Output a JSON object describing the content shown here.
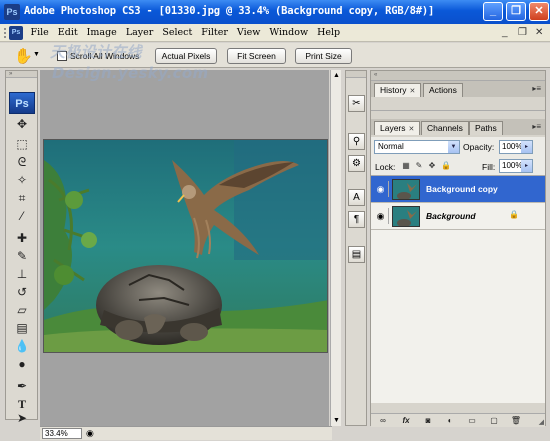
{
  "window": {
    "title": "Adobe Photoshop CS3 - [01330.jpg @ 33.4% (Background copy, RGB/8#)]",
    "logo": "Ps"
  },
  "menubar": {
    "items": [
      "File",
      "Edit",
      "Image",
      "Layer",
      "Select",
      "Filter",
      "View",
      "Window",
      "Help"
    ]
  },
  "watermark": {
    "line1": "天极设计在线",
    "line2": "Design.yesky.com"
  },
  "options": {
    "scroll_all_label": "Scroll All Windows",
    "scroll_all_checked": false,
    "actual_pixels": "Actual Pixels",
    "fit_screen": "Fit Screen",
    "print_size": "Print Size"
  },
  "toolbox": {
    "logo": "Ps",
    "tools": [
      "move-tool",
      "marquee-tool",
      "lasso-tool",
      "magic-wand-tool",
      "crop-tool",
      "slice-tool",
      "healing-brush-tool",
      "brush-tool",
      "clone-stamp-tool",
      "history-brush-tool",
      "eraser-tool",
      "gradient-tool",
      "blur-tool",
      "dodge-tool",
      "pen-tool",
      "type-tool",
      "path-selection-tool"
    ]
  },
  "status": {
    "zoom": "33.4%"
  },
  "panels": {
    "history_tabs": [
      "History",
      "Actions"
    ],
    "layers_tabs": [
      "Layers",
      "Channels",
      "Paths"
    ],
    "blend_mode": "Normal",
    "opacity_label": "Opacity:",
    "opacity": "100%",
    "lock_label": "Lock:",
    "fill_label": "Fill:",
    "fill": "100%",
    "layers": [
      {
        "name": "Background copy",
        "selected": true,
        "locked": false
      },
      {
        "name": "Background",
        "selected": false,
        "locked": true
      }
    ]
  }
}
